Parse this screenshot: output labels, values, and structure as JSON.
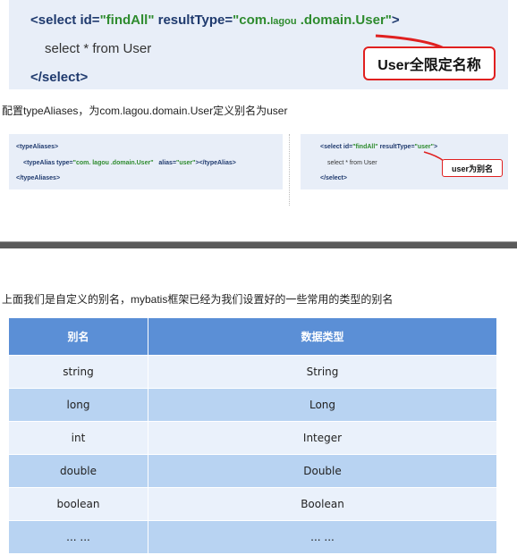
{
  "top_code": {
    "line1": {
      "open": "<select ",
      "attr1": "id=",
      "val1": "\"findAll\"",
      "attr2": " resultType=",
      "val2": "\"com.",
      "val2_small": "lagou",
      "val2_rest": " .domain.User\"",
      "close": ">"
    },
    "line2": "select * from User",
    "line3": "</select>",
    "callout": "User全限定名称"
  },
  "desc1": "配置typeAliases，为com.lagou.domain.User定义别名为user",
  "panel_left": {
    "line1": "<typeAliases>",
    "line2_pre": "<typeAlias type=",
    "line2_val": "\"com. lagou .domain.User\"",
    "line2_attr": "alias=",
    "line2_alias": "\"user\"",
    "line2_post": "></typeAlias>",
    "line3": "</typeAliases>"
  },
  "panel_right": {
    "line1_pre": "<select id=",
    "line1_id": "\"findAll\"",
    "line1_attr": " resultType=",
    "line1_val": "\"user\"",
    "line1_post": ">",
    "line2": "select * from User",
    "line3": "</select>",
    "callout": "user为别名"
  },
  "desc2": "上面我们是自定义的别名，mybatis框架已经为我们设置好的一些常用的类型的别名",
  "table": {
    "headers": [
      "别名",
      "数据类型"
    ],
    "rows": [
      [
        "string",
        "String"
      ],
      [
        "long",
        "Long"
      ],
      [
        "int",
        "Integer"
      ],
      [
        "double",
        "Double"
      ],
      [
        "boolean",
        "Boolean"
      ],
      [
        "... ...",
        "... ..."
      ]
    ]
  },
  "colors": {
    "code_bg": "#e8eef8",
    "callout_border": "#e02020",
    "table_header": "#5b8fd6",
    "table_row_dark": "#b8d3f2",
    "table_row_light": "#eaf1fb"
  }
}
